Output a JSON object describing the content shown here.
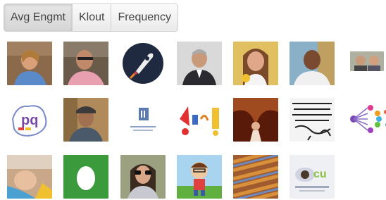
{
  "tabs": {
    "items": [
      {
        "label": "Avg Engmt",
        "active": true
      },
      {
        "label": "Klout",
        "active": false
      },
      {
        "label": "Frequency",
        "active": false
      }
    ]
  },
  "avatars": {
    "rows": [
      [
        {
          "name": "avatar-woman-blue-shirt",
          "bg": "#8a6a4a"
        },
        {
          "name": "avatar-man-pink-shirt",
          "bg": "#7a6a5c"
        },
        {
          "name": "avatar-rocket-logo",
          "bg": "#ffffff"
        },
        {
          "name": "avatar-man-suit",
          "bg": "#d9d9d9"
        },
        {
          "name": "avatar-woman-smiling",
          "bg": "#b07050"
        },
        {
          "name": "avatar-man-bald",
          "bg": "#6a8faa"
        },
        {
          "name": "avatar-two-people",
          "bg": "#9a9a90"
        }
      ],
      [
        {
          "name": "avatar-pq-logo",
          "bg": "#ffffff"
        },
        {
          "name": "avatar-man-hat",
          "bg": "#7a6a4a"
        },
        {
          "name": "avatar-blue-logo",
          "bg": "#ffffff"
        },
        {
          "name": "avatar-colorful-logo",
          "bg": "#ffffff"
        },
        {
          "name": "avatar-cave-figure",
          "bg": "#8a3a1a"
        },
        {
          "name": "avatar-handwritten-text",
          "bg": "#f4f4f4"
        },
        {
          "name": "avatar-share-dots",
          "bg": "#ffffff"
        }
      ],
      [
        {
          "name": "avatar-hand-child",
          "bg": "#d0b090"
        },
        {
          "name": "avatar-egg-icon",
          "bg": "#3b9a3b"
        },
        {
          "name": "avatar-woman-sunglasses",
          "bg": "#8a8a70"
        },
        {
          "name": "avatar-cartoon-boy",
          "bg": "#9ac8e8"
        },
        {
          "name": "avatar-woven-pattern",
          "bg": "#a0603a"
        },
        {
          "name": "avatar-cu-logo",
          "bg": "#e8e8f0"
        }
      ]
    ]
  },
  "colors": {
    "tab_border": "#cfcfcf",
    "tab_text": "#444444",
    "egg_green": "#3b9a3b"
  }
}
